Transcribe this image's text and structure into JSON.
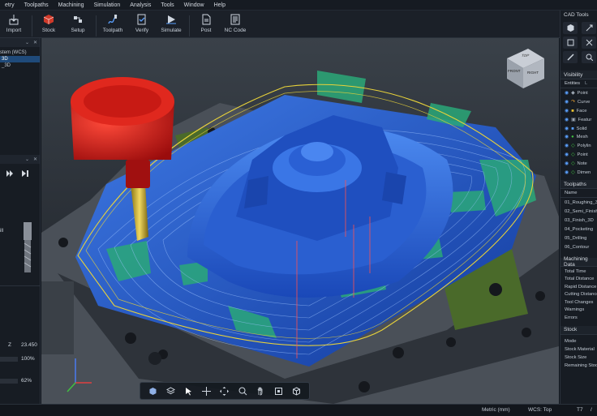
{
  "menu": [
    "etry",
    "Toolpaths",
    "Machining",
    "Simulation",
    "Analysis",
    "Tools",
    "Window",
    "Help"
  ],
  "ribbon": [
    {
      "label": "Import",
      "icon": "import-icon"
    },
    {
      "label": "Stock",
      "icon": "stock-cube-icon"
    },
    {
      "label": "Setup",
      "icon": "setup-icon"
    },
    {
      "label": "Toolpath",
      "icon": "toolpath-icon"
    },
    {
      "label": "Verify",
      "icon": "verify-icon"
    },
    {
      "label": "Simulate",
      "icon": "simulate-play-icon"
    },
    {
      "label": "Post",
      "icon": "post-document-icon"
    },
    {
      "label": "NC Code",
      "icon": "nc-code-icon"
    }
  ],
  "left": {
    "tree_items": [
      "stem (WCS)",
      "3D",
      "_3D"
    ],
    "stepper_values": {
      "z_label": "Z",
      "z_value": "23.450",
      "pct1": "100%",
      "pct2": "62%"
    },
    "tool_label": "ill"
  },
  "viewcube": {
    "top": "TOP",
    "front": "FRONT",
    "right": "RIGHT"
  },
  "right": {
    "cad_tools_title": "CAD Tools",
    "visibility_title": "Visibility",
    "visibility_tab": "Entities",
    "visibility_tab2": "L",
    "entities": [
      "Point",
      "Curve",
      "Face",
      "Featur",
      "Solid",
      "Mesh",
      "Polylin",
      "Point",
      "Note",
      "Dimen"
    ],
    "toolpaths_title": "Toolpaths",
    "toolpaths_col": "Name",
    "toolpaths": [
      "01_Roughing_3",
      "02_Semi_Finish",
      "03_Finish_3D",
      "04_Pocketing",
      "05_Drilling",
      "06_Contour"
    ],
    "machining_title": "Machining Data",
    "machining": [
      "Total Time",
      "Total Distance",
      "Rapid Distance",
      "Cutting Distance",
      "Tool Changes",
      "Warnings",
      "Errors"
    ],
    "stock_title": "Stock",
    "stock": [
      "Mode",
      "Stock Material",
      "Stock Size",
      "Remaining Stock"
    ]
  },
  "status": {
    "units": "Metric (mm)",
    "wcs": "WCS: Top",
    "tool": "T7",
    "extra": "/"
  },
  "colors": {
    "accent": "#1f6fd1",
    "part_blue": "#1e50c8",
    "toolpath_yellow": "#e8d23a",
    "cutter_red": "#d01818",
    "green_patch": "#2aa878"
  }
}
